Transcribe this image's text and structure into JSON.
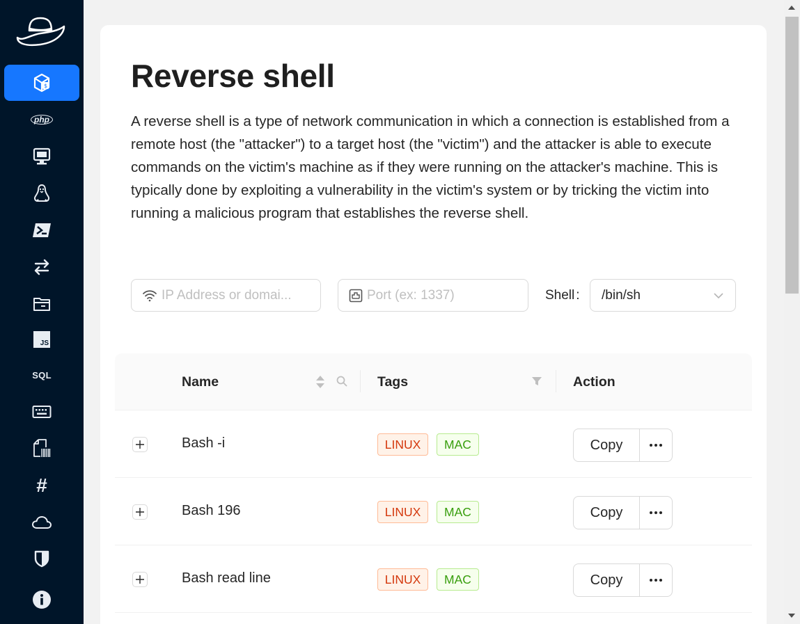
{
  "sidebar": {
    "items": [
      {
        "name": "reverse-shell",
        "icon": "shell-box-icon",
        "active": true
      },
      {
        "name": "php",
        "icon": "php-icon",
        "text": "php"
      },
      {
        "name": "msfvenom",
        "icon": "monitor-icon"
      },
      {
        "name": "linux",
        "icon": "linux-penguin-icon"
      },
      {
        "name": "powershell",
        "icon": "powershell-icon"
      },
      {
        "name": "transfer",
        "icon": "transfer-arrows-icon"
      },
      {
        "name": "file-browser",
        "icon": "folder-icon"
      },
      {
        "name": "javascript",
        "icon": "js-icon",
        "text": "JS"
      },
      {
        "name": "sql",
        "icon": "sql-icon",
        "text": "SQL"
      },
      {
        "name": "keyboard",
        "icon": "keyboard-icon"
      },
      {
        "name": "file-barcode",
        "icon": "file-barcode-icon"
      },
      {
        "name": "hash",
        "icon": "hash-icon",
        "text": "#"
      },
      {
        "name": "cloud",
        "icon": "cloud-icon"
      },
      {
        "name": "security",
        "icon": "shield-icon"
      },
      {
        "name": "about",
        "icon": "info-icon"
      }
    ]
  },
  "page": {
    "title": "Reverse shell",
    "description": "A reverse shell is a type of network communication in which a connection is established from a remote host (the \"attacker\") to a target host (the \"victim\") and the attacker is able to execute commands on the victim's machine as if they were running on the attacker's machine. This is typically done by exploiting a vulnerability in the victim's system or by tricking the victim into running a malicious program that establishes the reverse shell."
  },
  "form": {
    "ip_placeholder": "IP Address or domai...",
    "port_placeholder": "Port (ex: 1337)",
    "shell_label": "Shell",
    "shell_colon": ":",
    "shell_value": "/bin/sh"
  },
  "table": {
    "headers": {
      "name": "Name",
      "tags": "Tags",
      "action": "Action"
    },
    "rows": [
      {
        "name": "Bash -i",
        "tags": [
          "LINUX",
          "MAC"
        ],
        "action": "Copy"
      },
      {
        "name": "Bash 196",
        "tags": [
          "LINUX",
          "MAC"
        ],
        "action": "Copy"
      },
      {
        "name": "Bash read line",
        "tags": [
          "LINUX",
          "MAC"
        ],
        "action": "Copy"
      }
    ]
  },
  "colors": {
    "sidebar_bg": "#001529",
    "accent": "#1677ff",
    "linux_tag": "#d4380d",
    "mac_tag": "#389e0d"
  }
}
